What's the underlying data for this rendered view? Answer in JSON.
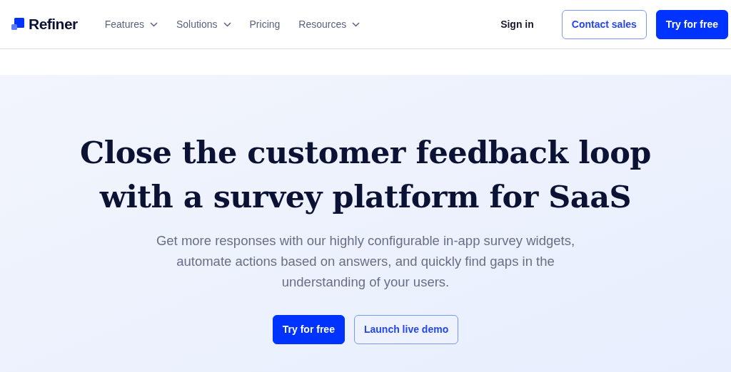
{
  "logo": {
    "name": "Refiner"
  },
  "nav": [
    {
      "label": "Features",
      "dropdown": true
    },
    {
      "label": "Solutions",
      "dropdown": true
    },
    {
      "label": "Pricing",
      "dropdown": false
    },
    {
      "label": "Resources",
      "dropdown": true
    }
  ],
  "header_actions": [
    {
      "label": "Sign in",
      "kind": "link"
    },
    {
      "label": "Contact sales",
      "kind": "outline"
    },
    {
      "label": "Try for free",
      "kind": "primary"
    }
  ],
  "hero": {
    "title": "Close the customer feedback loop with a survey platform for SaaS",
    "subtitle": "Get more responses with our highly configurable in-app survey widgets, automate actions based on answers, and quickly find gaps in the understanding of your users.",
    "buttons": [
      {
        "label": "Try for free",
        "kind": "primary"
      },
      {
        "label": "Launch live demo",
        "kind": "outline"
      }
    ]
  }
}
